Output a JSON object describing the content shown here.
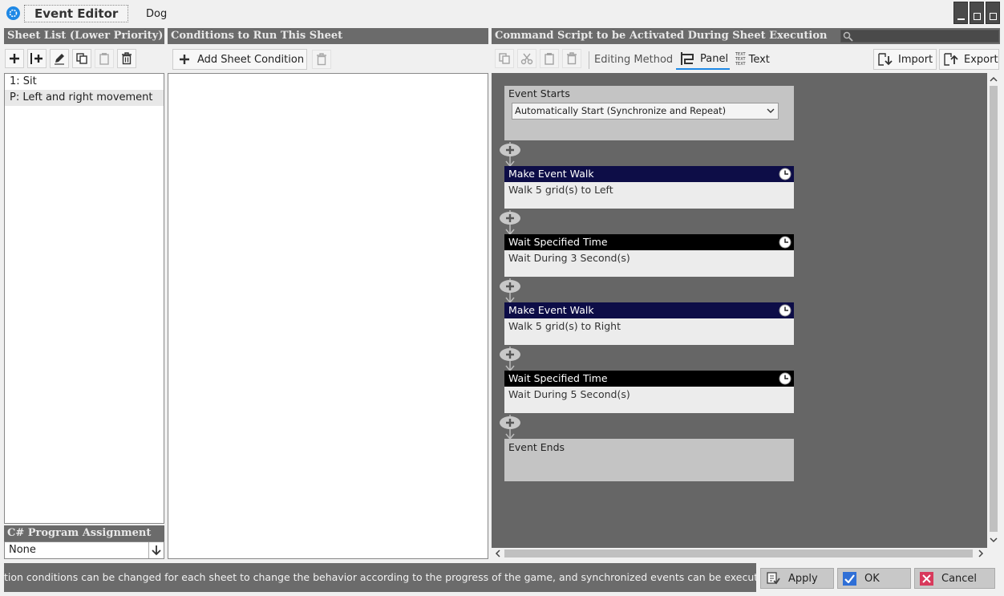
{
  "window": {
    "title": "Event Editor",
    "event_name": "Dog"
  },
  "sheet_list": {
    "header": "Sheet List (Lower Priority)",
    "items": [
      "1: Sit",
      "P: Left and right movement"
    ],
    "selected_index": 1
  },
  "csharp": {
    "header": "C# Program Assignment",
    "value": "None"
  },
  "conditions": {
    "header": "Conditions to Run This Sheet",
    "add_label": "Add Sheet Condition"
  },
  "script": {
    "header": "Command Script to be Activated During Sheet Execution",
    "editing_method_label": "Editing Method",
    "panel_label": "Panel",
    "text_label": "Text",
    "text_icon_caption": "TEXT",
    "import_label": "Import",
    "export_label": "Export",
    "event_starts": {
      "title": "Event Starts",
      "trigger": "Automatically Start (Synchronize and Repeat)"
    },
    "commands": [
      {
        "title": "Make Event Walk",
        "detail": "Walk 5 grid(s) to Left",
        "color": "#0d0d47"
      },
      {
        "title": "Wait Specified Time",
        "detail": "Wait During 3 Second(s)",
        "color": "#000000"
      },
      {
        "title": "Make Event Walk",
        "detail": "Walk 5 grid(s) to Right",
        "color": "#0d0d47"
      },
      {
        "title": "Wait Specified Time",
        "detail": "Wait During 5 Second(s)",
        "color": "#000000"
      }
    ],
    "event_ends": "Event Ends"
  },
  "status_text": "tion conditions can be changed for each sheet to change the behavior according to the progress of the game, and synchronized events can be executed at the",
  "buttons": {
    "apply": "Apply",
    "ok": "OK",
    "cancel": "Cancel"
  }
}
